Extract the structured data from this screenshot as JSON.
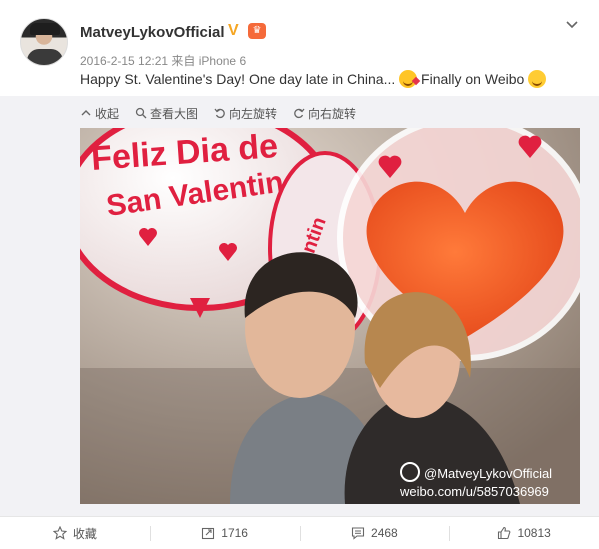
{
  "post": {
    "username": "MatveyLykovOfficial",
    "time": "2016-2-15 12:21 来自 iPhone 6",
    "text_part1": "Happy St. Valentine's Day! One day late in China...",
    "text_part2": "Finally on Weibo"
  },
  "toolbar": {
    "collapse": "收起",
    "view_large": "查看大图",
    "rotate_left": "向左旋转",
    "rotate_right": "向右旋转"
  },
  "photo": {
    "balloon_text_line1": "Feliz Dia de",
    "balloon_text_line2": "San Valentin",
    "balloon_text_side": "Valentin",
    "watermark_handle": "@MatveyLykovOfficial",
    "watermark_url": "weibo.com/u/5857036969"
  },
  "actions": {
    "favorite": "收藏",
    "repost": "1716",
    "comment": "2468",
    "like": "10813"
  },
  "colors": {
    "verified": "#f5a623",
    "balloon_red": "#e02040",
    "heart_orange": "#f05a28"
  }
}
